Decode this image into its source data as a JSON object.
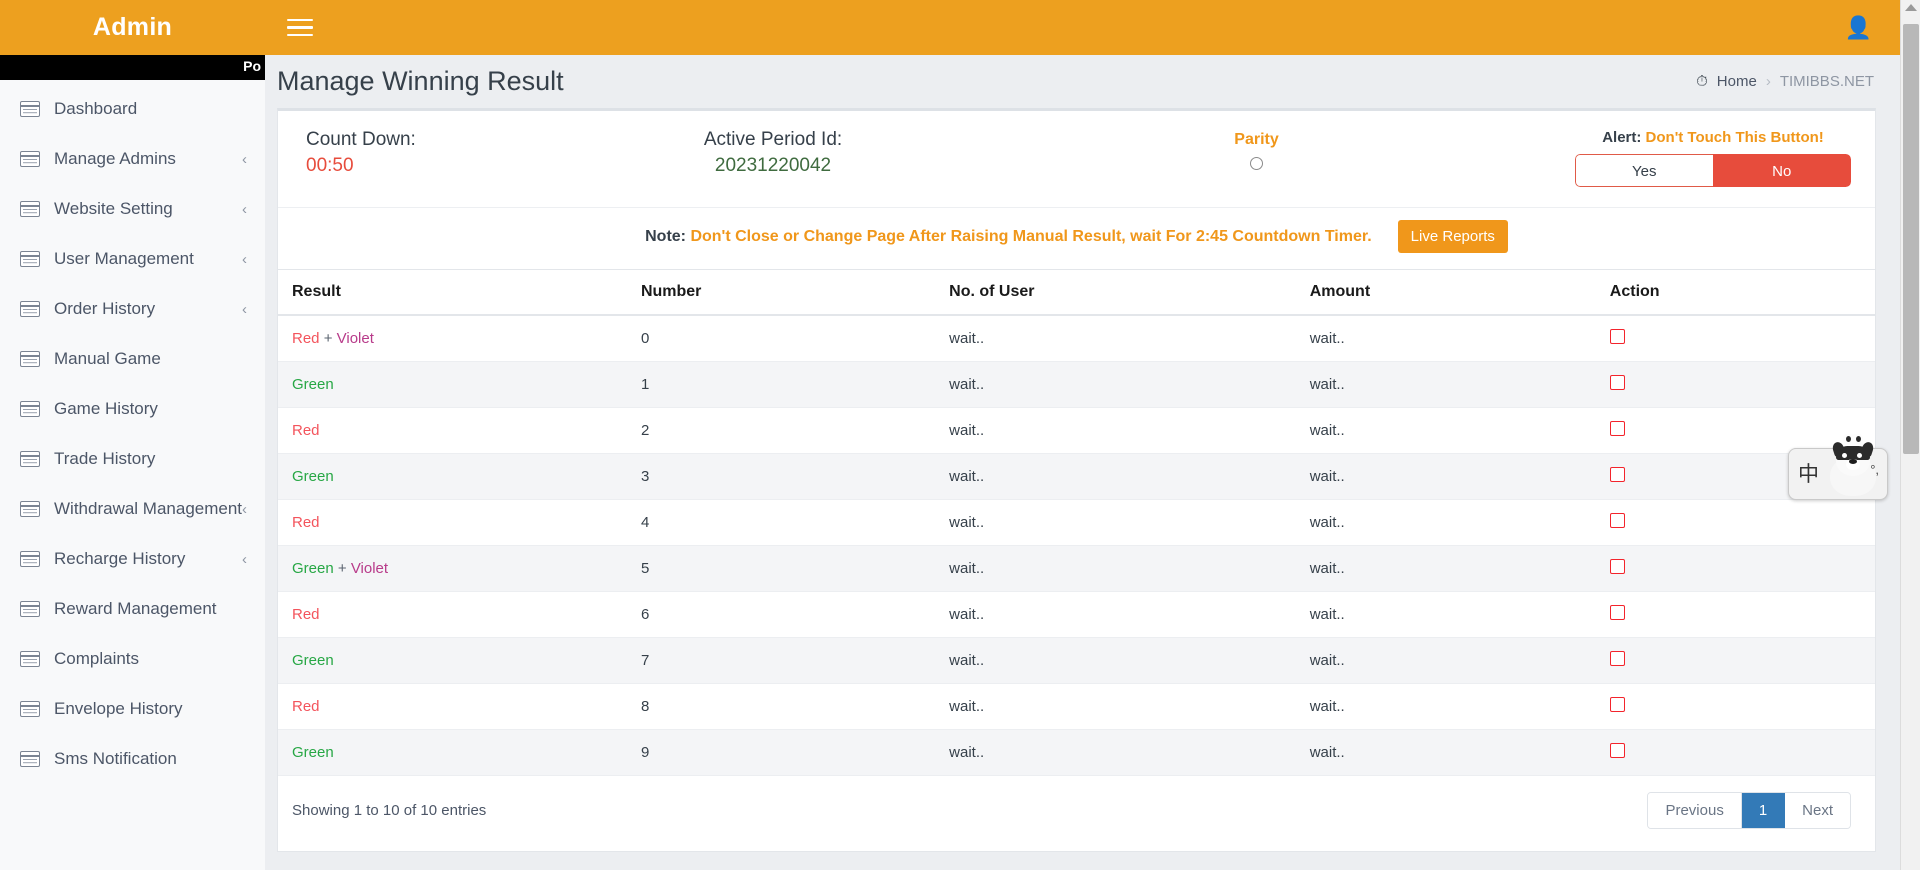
{
  "topbar": {
    "brand": "Admin",
    "menu_icon": "hamburger-icon",
    "user_icon": "user-icon"
  },
  "blackstrip": {
    "text": "Po"
  },
  "sidebar": {
    "items": [
      {
        "label": "Dashboard",
        "caret": ""
      },
      {
        "label": "Manage Admins",
        "caret": "‹"
      },
      {
        "label": "Website Setting",
        "caret": "‹"
      },
      {
        "label": "User Management",
        "caret": "‹"
      },
      {
        "label": "Order History",
        "caret": "‹"
      },
      {
        "label": "Manual Game",
        "caret": ""
      },
      {
        "label": "Game History",
        "caret": ""
      },
      {
        "label": "Trade History",
        "caret": ""
      },
      {
        "label": "Withdrawal Management",
        "caret": "‹"
      },
      {
        "label": "Recharge History",
        "caret": "‹"
      },
      {
        "label": "Reward Management",
        "caret": ""
      },
      {
        "label": "Complaints",
        "caret": ""
      },
      {
        "label": "Envelope History",
        "caret": ""
      },
      {
        "label": "Sms Notification",
        "caret": ""
      }
    ]
  },
  "page": {
    "title": "Manage Winning Result",
    "breadcrumb": {
      "icon": "dashboard-icon",
      "home": "Home",
      "separator": "›",
      "current": "TIMIBBS.NET"
    }
  },
  "info": {
    "countdown_label": "Count Down:",
    "countdown_value": "00:50",
    "period_label": "Active Period Id:",
    "period_value": "20231220042",
    "parity_label": "Parity",
    "alert_prefix": "Alert: ",
    "alert_text": "Don't Touch This Button!",
    "yes_label": "Yes",
    "no_label": "No"
  },
  "note": {
    "prefix": "Note: ",
    "text": "Don't Close or Change Page After Raising Manual Result, wait For 2:45 Countdown Timer.",
    "live_reports_label": "Live Reports"
  },
  "table": {
    "columns": [
      "Result",
      "Number",
      "No. of User",
      "Amount",
      "Action"
    ],
    "rows": [
      {
        "result": "Red + Violet",
        "parts": [
          {
            "t": "Red",
            "c": "r-red"
          },
          {
            "t": " + ",
            "c": "r-plus"
          },
          {
            "t": "Violet",
            "c": "r-violet"
          }
        ],
        "number": "0",
        "users": "wait..",
        "amount": "wait.."
      },
      {
        "result": "Green",
        "parts": [
          {
            "t": "Green",
            "c": "r-green"
          }
        ],
        "number": "1",
        "users": "wait..",
        "amount": "wait.."
      },
      {
        "result": "Red",
        "parts": [
          {
            "t": "Red",
            "c": "r-red"
          }
        ],
        "number": "2",
        "users": "wait..",
        "amount": "wait.."
      },
      {
        "result": "Green",
        "parts": [
          {
            "t": "Green",
            "c": "r-green"
          }
        ],
        "number": "3",
        "users": "wait..",
        "amount": "wait.."
      },
      {
        "result": "Red",
        "parts": [
          {
            "t": "Red",
            "c": "r-red"
          }
        ],
        "number": "4",
        "users": "wait..",
        "amount": "wait.."
      },
      {
        "result": "Green + Violet",
        "parts": [
          {
            "t": "Green",
            "c": "r-green"
          },
          {
            "t": " + ",
            "c": "r-plus"
          },
          {
            "t": "Violet",
            "c": "r-violet"
          }
        ],
        "number": "5",
        "users": "wait..",
        "amount": "wait.."
      },
      {
        "result": "Red",
        "parts": [
          {
            "t": "Red",
            "c": "r-red"
          }
        ],
        "number": "6",
        "users": "wait..",
        "amount": "wait.."
      },
      {
        "result": "Green",
        "parts": [
          {
            "t": "Green",
            "c": "r-green"
          }
        ],
        "number": "7",
        "users": "wait..",
        "amount": "wait.."
      },
      {
        "result": "Red",
        "parts": [
          {
            "t": "Red",
            "c": "r-red"
          }
        ],
        "number": "8",
        "users": "wait..",
        "amount": "wait.."
      },
      {
        "result": "Green",
        "parts": [
          {
            "t": "Green",
            "c": "r-green"
          }
        ],
        "number": "9",
        "users": "wait..",
        "amount": "wait.."
      }
    ]
  },
  "footer": {
    "entries": "Showing 1 to 10 of 10 entries",
    "pager": [
      {
        "label": "Previous",
        "active": false
      },
      {
        "label": "1",
        "active": true
      },
      {
        "label": "Next",
        "active": false
      }
    ]
  },
  "ime": {
    "mode": "中",
    "marks": "°,"
  },
  "colors": {
    "brand_orange": "#eda01f",
    "accent_orange": "#f0971b",
    "red": "#e74c3c",
    "result_red": "#f3545c",
    "result_green": "#27a745",
    "result_violet": "#b83b8a",
    "wait_orange": "#e8883a",
    "pager_active": "#337ab7"
  }
}
